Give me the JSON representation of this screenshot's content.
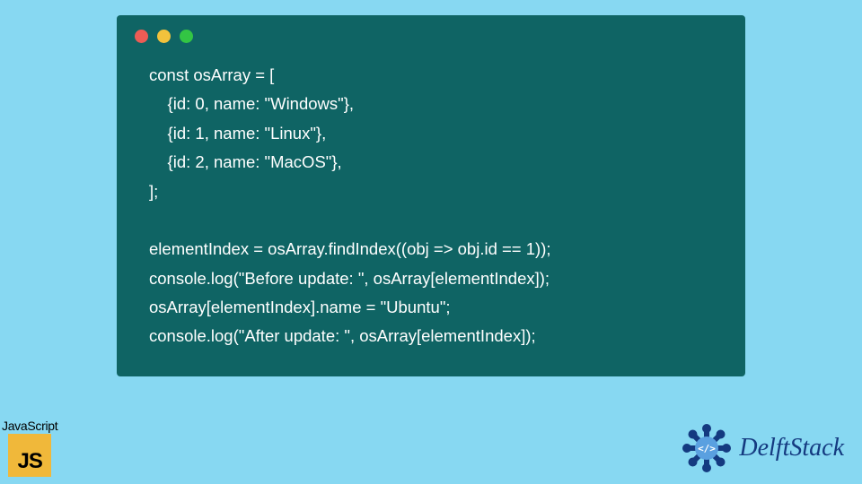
{
  "code": {
    "lines": [
      "const osArray = [",
      "    {id: 0, name: \"Windows\"},",
      "    {id: 1, name: \"Linux\"},",
      "    {id: 2, name: \"MacOS\"},",
      "];",
      "",
      "elementIndex = osArray.findIndex((obj => obj.id == 1));",
      "console.log(\"Before update: \", osArray[elementIndex]);",
      "osArray[elementIndex].name = \"Ubuntu\";",
      "console.log(\"After update: \", osArray[elementIndex]);"
    ]
  },
  "badges": {
    "js_label": "JavaScript",
    "js_short": "JS"
  },
  "logo": {
    "brand": "DelftStack"
  }
}
